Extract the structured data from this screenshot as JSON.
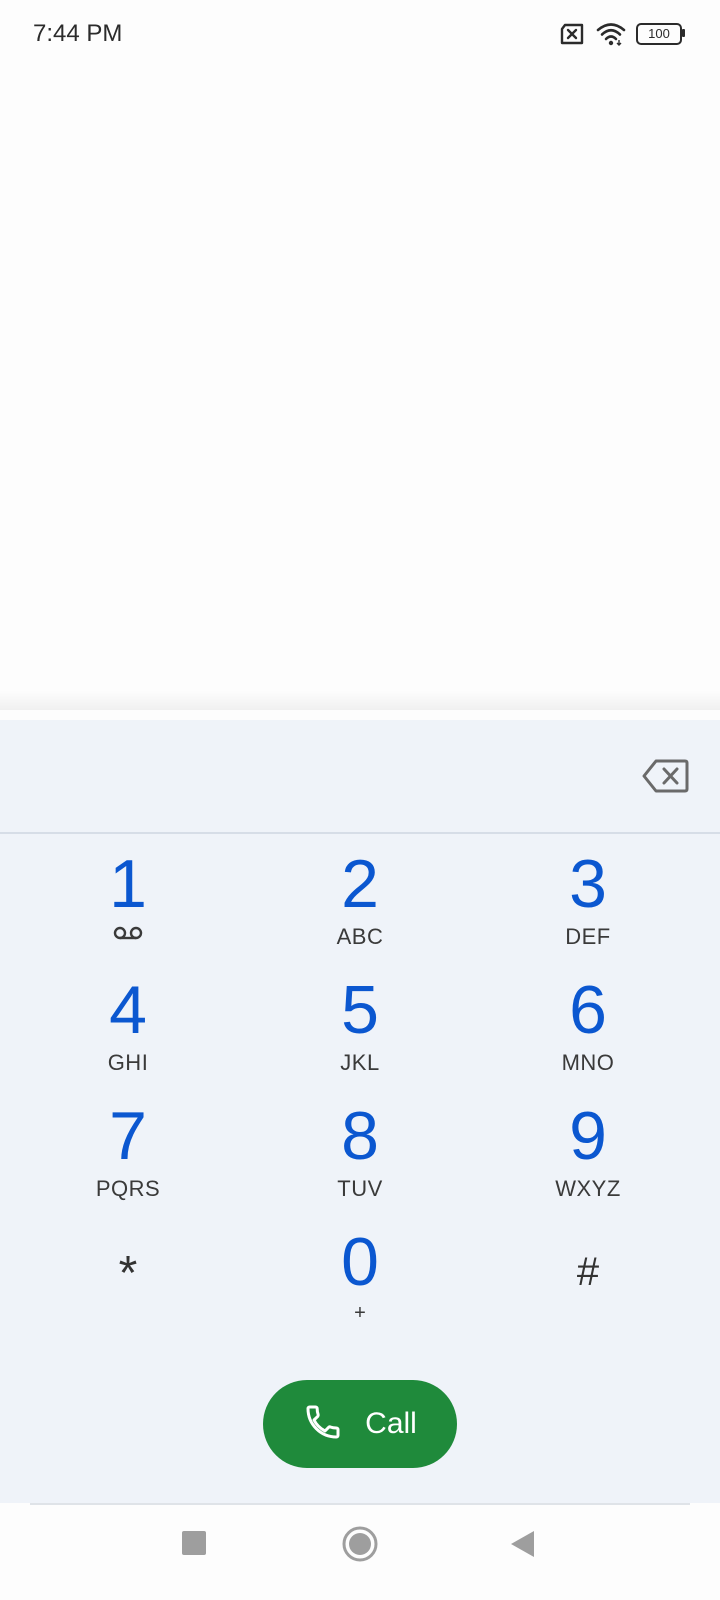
{
  "status_bar": {
    "time": "7:44 PM",
    "battery": "100",
    "icons": [
      "no-sim-icon",
      "wifi-icon",
      "battery-icon"
    ]
  },
  "dialer": {
    "digits_value": "",
    "keys": [
      {
        "digit": "1",
        "sub": "",
        "sub_icon": "voicemail-icon"
      },
      {
        "digit": "2",
        "sub": "ABC"
      },
      {
        "digit": "3",
        "sub": "DEF"
      },
      {
        "digit": "4",
        "sub": "GHI"
      },
      {
        "digit": "5",
        "sub": "JKL"
      },
      {
        "digit": "6",
        "sub": "MNO"
      },
      {
        "digit": "7",
        "sub": "PQRS"
      },
      {
        "digit": "8",
        "sub": "TUV"
      },
      {
        "digit": "9",
        "sub": "WXYZ"
      },
      {
        "digit": "*",
        "sub": ""
      },
      {
        "digit": "0",
        "sub": "+"
      },
      {
        "digit": "#",
        "sub": ""
      }
    ],
    "call_label": "Call"
  },
  "colors": {
    "accent": "#0b57d0",
    "call_button": "#1f8a3b",
    "sheet_bg": "#eff3f9"
  },
  "nav": {
    "icons": [
      "recents-icon",
      "home-icon",
      "back-icon"
    ]
  }
}
